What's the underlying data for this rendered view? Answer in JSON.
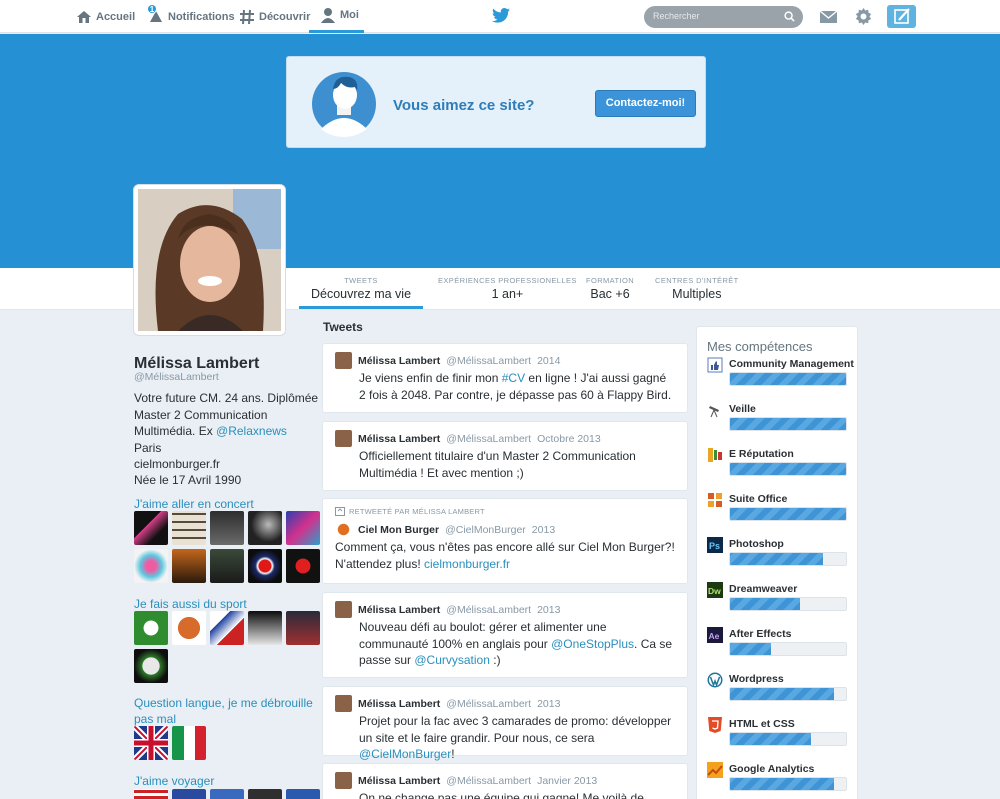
{
  "nav": {
    "items": [
      {
        "label": "Accueil",
        "icon": "home-icon"
      },
      {
        "label": "Notifications",
        "icon": "notifications-icon",
        "badge": "1"
      },
      {
        "label": "Découvrir",
        "icon": "hashtag-icon"
      },
      {
        "label": "Moi",
        "icon": "user-icon"
      }
    ],
    "search_placeholder": "Rechercher"
  },
  "promo": {
    "title": "Vous aimez ce site?",
    "button": "Contactez-moi!"
  },
  "stats": [
    {
      "label": "TWEETS",
      "value": "Découvrez ma vie"
    },
    {
      "label": "EXPÉRIENCES PROFESSIONELLES",
      "value": "1 an+"
    },
    {
      "label": "FORMATION",
      "value": "Bac +6"
    },
    {
      "label": "CENTRES D'INTÉRÊT",
      "value": "Multiples"
    }
  ],
  "profile": {
    "name": "Mélissa Lambert",
    "handle": "@MélissaLambert",
    "bio": "Votre future CM. 24 ans. Diplômée Master 2 Communication Multimédia. Ex ",
    "bio_link": "@Relaxnews",
    "location": "Paris",
    "website": "cielmonburger.fr",
    "birth": "Née le 17 Avril 1990"
  },
  "sections": {
    "concert": "J'aime aller en concert",
    "sport": "Je fais aussi du sport",
    "langue": "Question langue, je me débrouille pas mal",
    "voyage": "J'aime voyager"
  },
  "tweets_heading": "Tweets",
  "tweets": [
    {
      "name": "Mélissa Lambert",
      "handle": "@MélissaLambert",
      "date": "2014",
      "t1": "Je viens enfin de finir mon ",
      "l1": "#CV",
      "t2": " en ligne ! J'ai aussi gagné 2 fois à 2048. Par contre, je dépasse pas 60 à Flappy Bird.",
      "l2": "",
      "t3": ""
    },
    {
      "name": "Mélissa Lambert",
      "handle": "@MélissaLambert",
      "date": "Octobre 2013",
      "t1": "Officiellement titulaire d'un Master 2 Communication Multimédia ! Et avec mention ;)",
      "l1": "",
      "t2": "",
      "l2": "",
      "t3": ""
    },
    {
      "retweet_label": "RETWEETÉ PAR MÉLISSA LAMBERT",
      "name": "Ciel Mon Burger",
      "handle": "@CielMonBurger",
      "date": "2013",
      "t1": "Comment ça, vous n'êtes pas encore allé sur Ciel Mon Burger?! N'attendez plus! ",
      "l1": "cielmonburger.fr",
      "t2": "",
      "l2": "",
      "t3": ""
    },
    {
      "name": "Mélissa Lambert",
      "handle": "@MélissaLambert",
      "date": "2013",
      "t1": "Nouveau défi au boulot: gérer et alimenter une communauté 100% en anglais pour ",
      "l1": "@OneStopPlus",
      "t2": ". Ca se passe sur ",
      "l2": "@Curvysation",
      "t3": " :)"
    },
    {
      "name": "Mélissa Lambert",
      "handle": "@MélissaLambert",
      "date": "2013",
      "t1": "Projet pour la fac avec 3 camarades de promo: développer un site et le faire grandir. Pour nous, ce sera ",
      "l1": "@CielMonBurger",
      "t2": "!",
      "l2": "",
      "t3": ""
    },
    {
      "name": "Mélissa Lambert",
      "handle": "@MélissaLambert",
      "date": "Janvier 2013",
      "t1": "On ne change pas une équipe qui gagne! Me voilà de retour",
      "l1": "",
      "t2": "",
      "l2": "",
      "t3": ""
    }
  ],
  "skills": {
    "title": "Mes compétences",
    "items": [
      {
        "name": "Community Management",
        "level": 1.0,
        "icon": "thumbs-up-icon"
      },
      {
        "name": "Veille",
        "level": 1.0,
        "icon": "telescope-icon"
      },
      {
        "name": "E Réputation",
        "level": 1.0,
        "icon": "reputation-icon"
      },
      {
        "name": "Suite Office",
        "level": 1.0,
        "icon": "office-icon"
      },
      {
        "name": "Photoshop",
        "level": 0.8,
        "icon": "photoshop-icon"
      },
      {
        "name": "Dreamweaver",
        "level": 0.6,
        "icon": "dreamweaver-icon"
      },
      {
        "name": "After Effects",
        "level": 0.35,
        "icon": "after-effects-icon"
      },
      {
        "name": "Wordpress",
        "level": 0.9,
        "icon": "wordpress-icon"
      },
      {
        "name": "HTML et CSS",
        "level": 0.7,
        "icon": "html5-icon"
      },
      {
        "name": "Google Analytics",
        "level": 0.9,
        "icon": "analytics-icon"
      }
    ]
  },
  "colors": {
    "accent": "#2a9ad8",
    "banner": "#2591d4",
    "link": "#2a8fbd"
  }
}
